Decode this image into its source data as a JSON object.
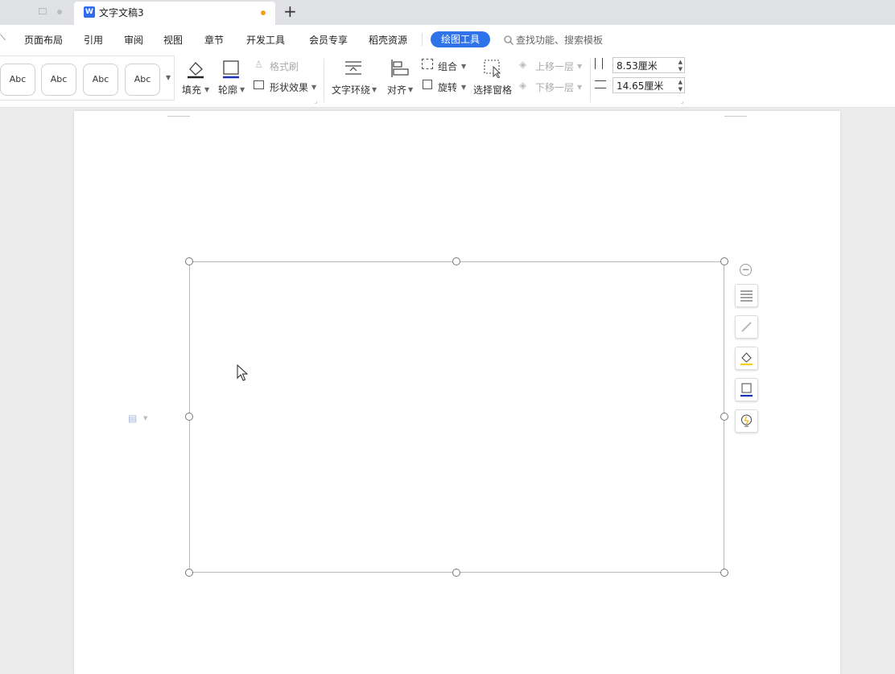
{
  "tabs": {
    "active_title": "文字文稿3",
    "active_icon": "W",
    "add_label": "+"
  },
  "menu": {
    "items": [
      "页面布局",
      "引用",
      "审阅",
      "视图",
      "章节",
      "开发工具",
      "会员专享",
      "稻壳资源"
    ],
    "active": "绘图工具",
    "search_placeholder": "查找功能、搜索模板"
  },
  "ribbon": {
    "style_presets": [
      "Abc",
      "Abc",
      "Abc",
      "Abc"
    ],
    "fill": "填充",
    "outline": "轮廓",
    "format_painter": "格式刷",
    "shape_effects": "形状效果",
    "text_wrap": "文字环绕",
    "align": "对齐",
    "group": "组合",
    "rotate": "旋转",
    "selection_pane": "选择窗格",
    "bring_forward": "上移一层",
    "send_backward": "下移一层",
    "height_value": "8.53厘米",
    "width_value": "14.65厘米"
  },
  "colors": {
    "accent": "#2f73ea",
    "unsaved_dot": "#f0a020",
    "outline_blue": "#1b2fb5",
    "fill_yellow": "#f2d21b"
  }
}
